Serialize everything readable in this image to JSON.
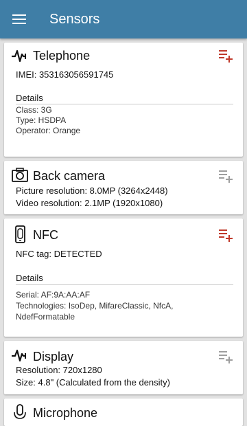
{
  "appbar": {
    "title": "Sensors",
    "menu_icon": "hamburger-menu-icon",
    "color": "#3f7ea6"
  },
  "accent_color": "#c0392b",
  "inactive_color": "#9e9e9e",
  "cards": {
    "telephone": {
      "title": "Telephone",
      "icon": "pulse-icon",
      "imei": "IMEI: 353163056591745",
      "details_label": "Details",
      "class": "Class: 3G",
      "type": "Type: HSDPA",
      "operator": "Operator: Orange"
    },
    "back_camera": {
      "title": "Back camera",
      "icon": "camera-icon",
      "picture_resolution": "Picture resolution: 8.0MP (3264x2448)",
      "video_resolution": "Video resolution: 2.1MP (1920x1080)"
    },
    "nfc": {
      "title": "NFC",
      "icon": "phone-nfc-icon",
      "tag": "NFC tag: DETECTED",
      "details_label": "Details",
      "serial": "Serial: AF:9A:AA:AF",
      "technologies_line1": "Technologies: IsoDep, MifareClassic, NfcA,",
      "technologies_line2": "NdefFormatable"
    },
    "display": {
      "title": "Display",
      "icon": "pulse-icon",
      "resolution": "Resolution: 720x1280",
      "size": "Size: 4.8\" (Calculated from the density)"
    },
    "microphone": {
      "title": "Microphone",
      "icon": "microphone-icon"
    }
  }
}
